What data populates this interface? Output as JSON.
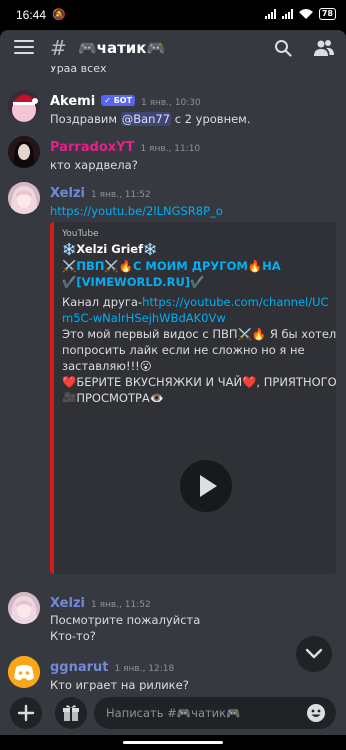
{
  "status": {
    "time": "16:44",
    "battery": "78"
  },
  "channel": {
    "title": "🎮чатик🎮"
  },
  "chat": {
    "cut_text": "Ураа всех",
    "messages": [
      {
        "author": "Akemi",
        "badge": "БОТ",
        "time": "1 янв., 10:30",
        "text_before": "Поздравим ",
        "mention": "@Ban77",
        "text_after": " с 2 уровнем.",
        "name_color": "#ffffff"
      },
      {
        "author": "ParradoxYT",
        "time": "1 янв., 11:10",
        "text": "кто хардвела?",
        "name_color": "#e91e8c"
      },
      {
        "author": "Xelzi",
        "time": "1 янв., 11:52",
        "link": "https://youtu.be/2lLNGSR8P_o",
        "name_color": "#7289da"
      },
      {
        "author": "Xelzi",
        "time": "1 янв., 11:52",
        "line1": "Посмотрите пожалуйста",
        "line2": "Кто-то?",
        "name_color": "#7289da"
      },
      {
        "author": "ggnarut",
        "time": "1 янв., 12:18",
        "text": "Кто играет на рилике?",
        "name_color": "#7289da"
      }
    ],
    "embed": {
      "provider": "YouTube",
      "title": "❄️Xelzi Grief❄️",
      "subtitle": "⚔️ПВП⚔️🔥С МОИМ ДРУГОМ🔥НА ✔️[VIMEWORLD.RU]✔️",
      "desc_prefix": "Канал друга-",
      "desc_link": "https://youtube.com/channel/UCm5C-wNalrHSejhWBdAK0Vw",
      "desc_body": "Это мой первый видос с ПВП⚔️🔥 Я бы хотел попросить лайк если не сложно но я не заставляю!!!😮",
      "desc_end": "❤️БЕРИТЕ ВКУСНЯЖКИ И ЧАЙ❤️, ПРИЯТНОГО 🎥ПРОСМОТРА👁️"
    }
  },
  "input": {
    "placeholder": "Написать #🎮чатик🎮"
  },
  "icons": {
    "menu": "menu-icon",
    "hash": "hash-icon",
    "search": "search-icon",
    "members": "members-icon",
    "plus": "plus-icon",
    "gift": "gift-icon",
    "emoji": "emoji-icon",
    "play": "play-icon",
    "chevron": "chevron-down-icon"
  },
  "colors": {
    "background": "#36393f",
    "input": "#202225",
    "link": "#00aff4",
    "embed_border": "#d41c1c",
    "bot_badge": "#5865f2"
  }
}
